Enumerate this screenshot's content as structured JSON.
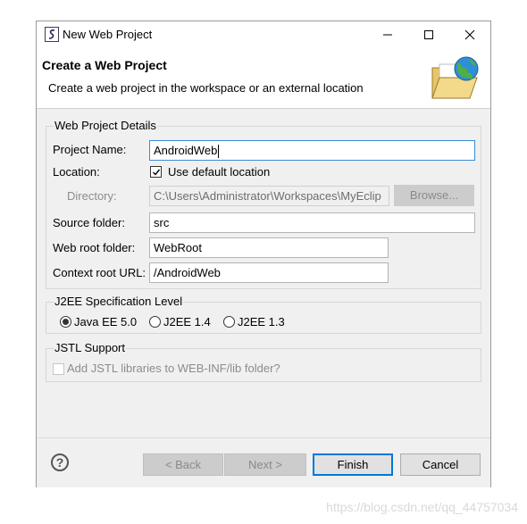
{
  "window": {
    "title": "New Web Project",
    "app_icon": "myeclipse-icon"
  },
  "header": {
    "title": "Create a Web Project",
    "description": "Create a web project in the workspace or an external location",
    "icon": "folder-globe-icon"
  },
  "details": {
    "legend": "Web Project Details",
    "project_name_label": "Project Name:",
    "project_name_value": "AndroidWeb",
    "location_label": "Location:",
    "use_default_label": "Use default location",
    "use_default_checked": true,
    "directory_label": "Directory:",
    "directory_value": "C:\\Users\\Administrator\\Workspaces\\MyEclip",
    "browse_label": "Browse...",
    "source_folder_label": "Source folder:",
    "source_folder_value": "src",
    "web_root_label": "Web root folder:",
    "web_root_value": "WebRoot",
    "context_root_label": "Context root URL:",
    "context_root_value": "/AndroidWeb"
  },
  "j2ee": {
    "legend": "J2EE Specification Level",
    "options": [
      "Java EE 5.0",
      "J2EE 1.4",
      "J2EE 1.3"
    ],
    "selected": "Java EE 5.0"
  },
  "jstl": {
    "legend": "JSTL Support",
    "add_jstl_label": "Add JSTL libraries to WEB-INF/lib folder?",
    "checked": false
  },
  "footer": {
    "back_label": "< Back",
    "next_label": "Next >",
    "finish_label": "Finish",
    "cancel_label": "Cancel"
  },
  "watermark": "https://blog.csdn.net/qq_44757034",
  "colors": {
    "focus_border": "#3b8ad8",
    "default_button_border": "#0078d7",
    "dialog_bg": "#f0f0f0"
  }
}
